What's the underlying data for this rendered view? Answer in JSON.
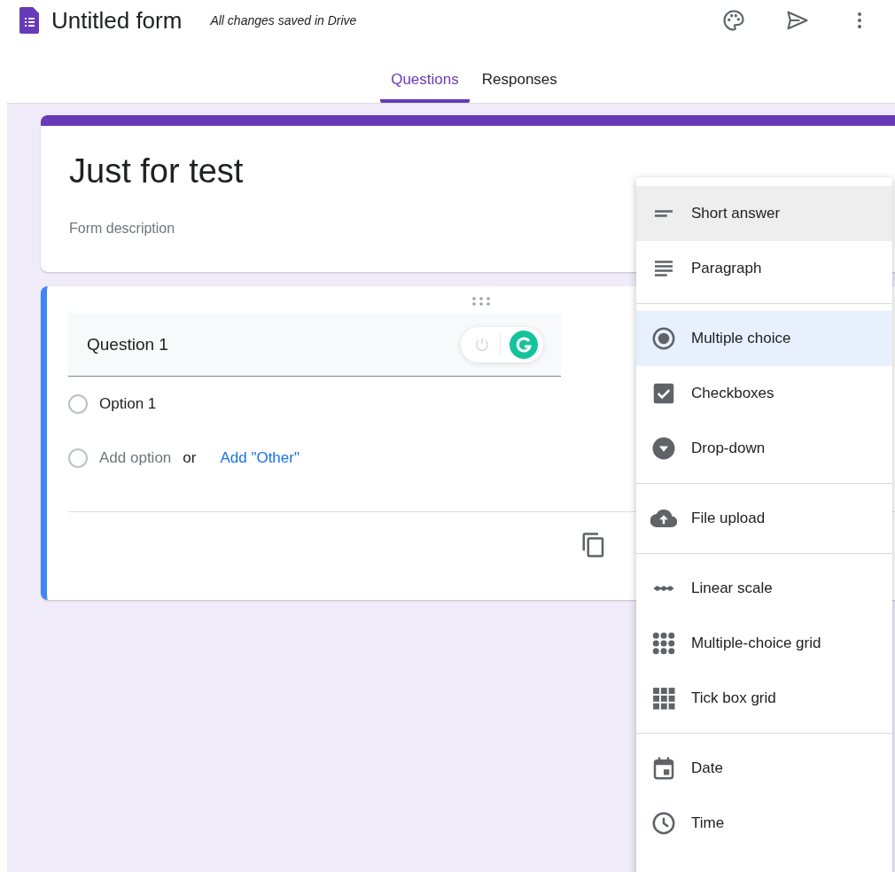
{
  "header": {
    "title": "Untitled form",
    "save_status": "All changes saved in Drive"
  },
  "tabs": [
    {
      "label": "Questions",
      "selected": true
    },
    {
      "label": "Responses",
      "selected": false
    }
  ],
  "title_card": {
    "title": "Just for test",
    "description_placeholder": "Form description"
  },
  "question": {
    "title": "Question 1",
    "options": [
      {
        "label": "Option 1"
      }
    ],
    "add_option": "Add option",
    "or": "or",
    "add_other": "Add \"Other\""
  },
  "type_menu": [
    {
      "items": [
        {
          "kind": "short",
          "label": "Short answer",
          "highlighted": true,
          "selected": false
        },
        {
          "kind": "paragraph",
          "label": "Paragraph",
          "highlighted": false,
          "selected": false
        }
      ]
    },
    {
      "items": [
        {
          "kind": "radio",
          "label": "Multiple choice",
          "highlighted": false,
          "selected": true
        },
        {
          "kind": "checkbox",
          "label": "Checkboxes",
          "highlighted": false,
          "selected": false
        },
        {
          "kind": "dropdown",
          "label": "Drop-down",
          "highlighted": false,
          "selected": false
        }
      ]
    },
    {
      "items": [
        {
          "kind": "upload",
          "label": "File upload",
          "highlighted": false,
          "selected": false
        }
      ]
    },
    {
      "items": [
        {
          "kind": "scale",
          "label": "Linear scale",
          "highlighted": false,
          "selected": false
        },
        {
          "kind": "mcgrid",
          "label": "Multiple-choice grid",
          "highlighted": false,
          "selected": false
        },
        {
          "kind": "tickgrid",
          "label": "Tick box grid",
          "highlighted": false,
          "selected": false
        }
      ]
    },
    {
      "items": [
        {
          "kind": "date",
          "label": "Date",
          "highlighted": false,
          "selected": false
        },
        {
          "kind": "time",
          "label": "Time",
          "highlighted": false,
          "selected": false
        }
      ]
    }
  ]
}
